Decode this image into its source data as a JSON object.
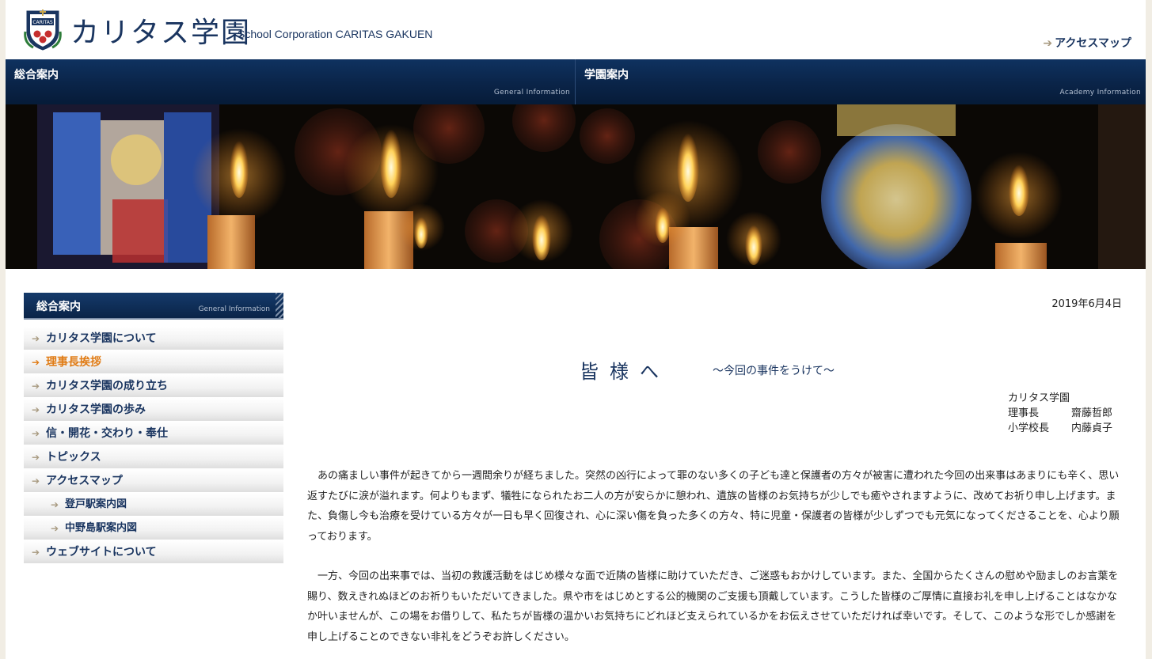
{
  "header": {
    "logo_text": "カリタス学園",
    "logo_sub": "School Corporation CARITAS GAKUEN",
    "logo_badge": "CARITAS",
    "access_label": "アクセスマップ"
  },
  "nav": {
    "items": [
      {
        "ja": "総合案内",
        "en": "General Information"
      },
      {
        "ja": "学園案内",
        "en": "Academy Information"
      }
    ]
  },
  "sidebar": {
    "heading_ja": "総合案内",
    "heading_en": "General Information",
    "items": [
      {
        "label": "カリタス学園について",
        "level": 1,
        "active": false
      },
      {
        "label": "理事長挨拶",
        "level": 1,
        "active": true
      },
      {
        "label": "カリタス学園の成り立ち",
        "level": 1,
        "active": false
      },
      {
        "label": "カリタス学園の歩み",
        "level": 1,
        "active": false
      },
      {
        "label": "信・開花・交わり・奉仕",
        "level": 1,
        "active": false
      },
      {
        "label": "トピックス",
        "level": 1,
        "active": false
      },
      {
        "label": "アクセスマップ",
        "level": 1,
        "active": false
      },
      {
        "label": "登戸駅案内図",
        "level": 2,
        "active": false
      },
      {
        "label": "中野島駅案内図",
        "level": 2,
        "active": false
      },
      {
        "label": "ウェブサイトについて",
        "level": 1,
        "active": false
      }
    ]
  },
  "main": {
    "date": "2019年6月4日",
    "title": "皆様へ",
    "subtitle": "〜今回の事件をうけて〜",
    "org": "カリタス学園",
    "signers": [
      {
        "role": "理事長",
        "name": "齋藤哲郎"
      },
      {
        "role": "小学校長",
        "name": "内藤貞子"
      }
    ],
    "paragraphs": [
      "あの痛ましい事件が起きてから一週間余りが経ちました。突然の凶行によって罪のない多くの子ども達と保護者の方々が被害に遭われた今回の出来事はあまりにも辛く、思い返すたびに涙が溢れます。何よりもまず、犠牲になられたお二人の方が安らかに憩われ、遺族の皆様のお気持ちが少しでも癒やされますように、改めてお祈り申し上げます。また、負傷し今も治療を受けている方々が一日も早く回復され、心に深い傷を負った多くの方々、特に児童・保護者の皆様が少しずつでも元気になってくださることを、心より願っております。",
      "一方、今回の出来事では、当初の救護活動をはじめ様々な面で近隣の皆様に助けていただき、ご迷惑もおかけしています。また、全国からたくさんの慰めや励ましのお言葉を賜り、数えきれぬほどのお祈りもいただいてきました。県や市をはじめとする公的機関のご支援も頂戴しています。こうした皆様のご厚情に直接お礼を申し上げることはなかなか叶いませんが、この場をお借りして、私たちが皆様の温かいお気持ちにどれほど支えられているかをお伝えさせていただければ幸いです。そして、このような形でしか感謝を申し上げることのできない非礼をどうぞお許しください。"
    ]
  }
}
